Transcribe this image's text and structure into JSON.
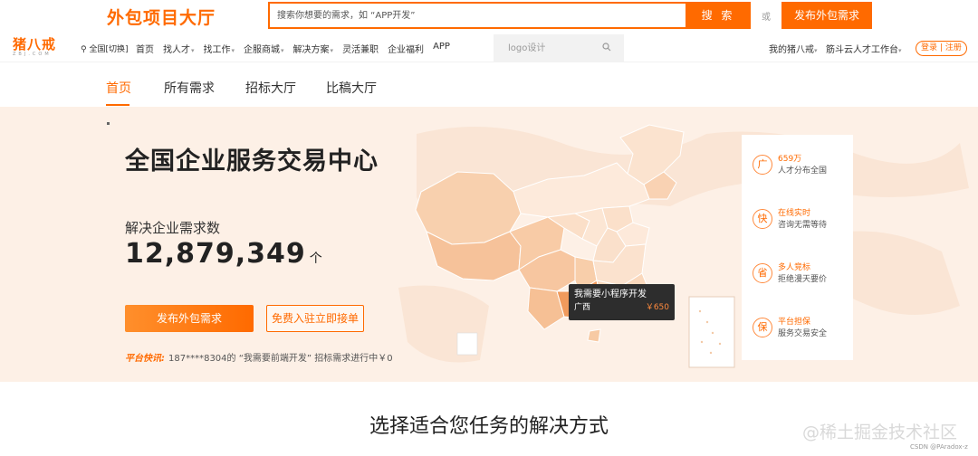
{
  "topbar": {
    "hall_title": "外包项目大厅",
    "search_placeholder": "搜索你想要的需求，如 “APP开发”",
    "search_button": "搜 索",
    "or_text": "或",
    "publish_button": "发布外包需求"
  },
  "global_nav": {
    "logo_main": "猪八戒",
    "logo_sub": "ZBJ.COM",
    "city": "全国[切换]",
    "items": [
      {
        "label": "首页",
        "dropdown": false
      },
      {
        "label": "找人才",
        "dropdown": true
      },
      {
        "label": "找工作",
        "dropdown": true
      },
      {
        "label": "企服商城",
        "dropdown": true
      },
      {
        "label": "解决方案",
        "dropdown": true
      },
      {
        "label": "灵活兼职",
        "dropdown": false
      },
      {
        "label": "企业福利",
        "dropdown": false
      },
      {
        "label": "APP",
        "dropdown": false
      }
    ],
    "search_placeholder": "logo设计",
    "my_zbj": "我的猪八戒",
    "workbench": "筋斗云人才工作台",
    "login": "登录",
    "register": "注册"
  },
  "sub_nav": {
    "tabs": [
      {
        "label": "首页",
        "active": true
      },
      {
        "label": "所有需求",
        "active": false
      },
      {
        "label": "招标大厅",
        "active": false
      },
      {
        "label": "比稿大厅",
        "active": false
      }
    ]
  },
  "hero": {
    "title": "全国企业服务交易中心",
    "count_label": "解决企业需求数",
    "count_value": "12,879,349",
    "count_unit": "个",
    "publish_button": "发布外包需求",
    "join_button": "免费入驻立即接单",
    "ticker_badge": "平台快讯:",
    "ticker_text": "187****8304的 “我需要前端开发” 招标需求进行中￥0",
    "tooltip": {
      "title": "我需要小程序开发",
      "region": "广西",
      "price": "￥650"
    }
  },
  "features": [
    {
      "icon": "广",
      "title": "659万",
      "desc": "人才分布全国"
    },
    {
      "icon": "快",
      "title": "在线实时",
      "desc": "咨询无需等待"
    },
    {
      "icon": "省",
      "title": "多人竞标",
      "desc": "拒绝漫天要价"
    },
    {
      "icon": "保",
      "title": "平台担保",
      "desc": "服务交易安全"
    }
  ],
  "section": {
    "title": "选择适合您任务的解决方式"
  },
  "watermark": "@稀土掘金技术社区",
  "credit": "CSDN @PAradox-z",
  "colors": {
    "accent": "#ff6a00",
    "hero_bg": "#fdf0e6",
    "tooltip_bg": "#2d2d2d"
  }
}
